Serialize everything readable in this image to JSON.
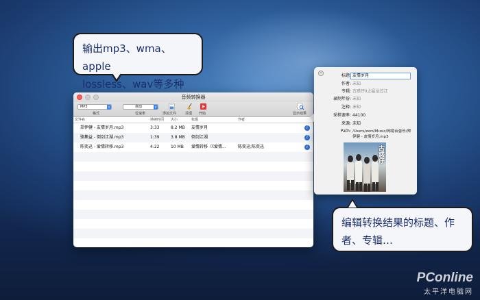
{
  "bubbles": {
    "top": [
      "输出mp3、wma、apple",
      "lossless、wav等多种格式"
    ],
    "bottom": [
      "编辑转换结果的标题、作",
      "者、专辑…"
    ]
  },
  "window": {
    "title": "音频转换器",
    "toolbar": {
      "format_value": "MP3",
      "format_label": "格式",
      "bitrate_value": "自动",
      "bitrate_label": "位速率",
      "add_label": "添加文件",
      "clear_label": "清理",
      "start_label": "开始",
      "show_label": "显示结果"
    },
    "columns": [
      "文件名",
      "持续时间",
      "大小",
      "标题",
      "作者",
      ""
    ],
    "rows": [
      {
        "file": "郑伊健 - 友情岁月.mp3",
        "duration": "3:33",
        "size": "8.2 MB",
        "title": "友情岁月",
        "author": ""
      },
      {
        "file": "骆集益 - 倒剑江湖.mp3",
        "duration": "1:39",
        "size": "3.8 MB",
        "title": "倒剑江湖",
        "author": ""
      },
      {
        "file": "陈奕迅 - 爱情转移.mp3",
        "duration": "4:22",
        "size": "10 MB",
        "title": "爱情转移（《爱情...",
        "author": "陈奕迅;陈奕迅"
      }
    ]
  },
  "panel": {
    "fields": [
      {
        "label": "标题:",
        "value": "友情岁月",
        "gray": false
      },
      {
        "label": "作者:",
        "value": "未知",
        "gray": true
      },
      {
        "label": "专辑:",
        "value": "古惑仔II之猛龙过江",
        "gray": true
      },
      {
        "label": "录制年份:",
        "value": "未知",
        "gray": true
      },
      {
        "label": "注释:",
        "value": "未知",
        "gray": true
      },
      {
        "label": "采样速率:",
        "value": "44100",
        "gray": false
      },
      {
        "label": "来源:",
        "value": "未知",
        "gray": false
      },
      {
        "label": "Path:",
        "value": "/Users/zero/Music/网易云音乐/郑伊健 - 友情岁月.mp3",
        "gray": false
      }
    ],
    "cover_text": "古惑仔"
  },
  "watermark": {
    "line1": "PConline",
    "line2": "太平洋电脑网"
  },
  "colors": {
    "accent": "#3d82e6",
    "bubble_text": "#1c2f6b"
  }
}
